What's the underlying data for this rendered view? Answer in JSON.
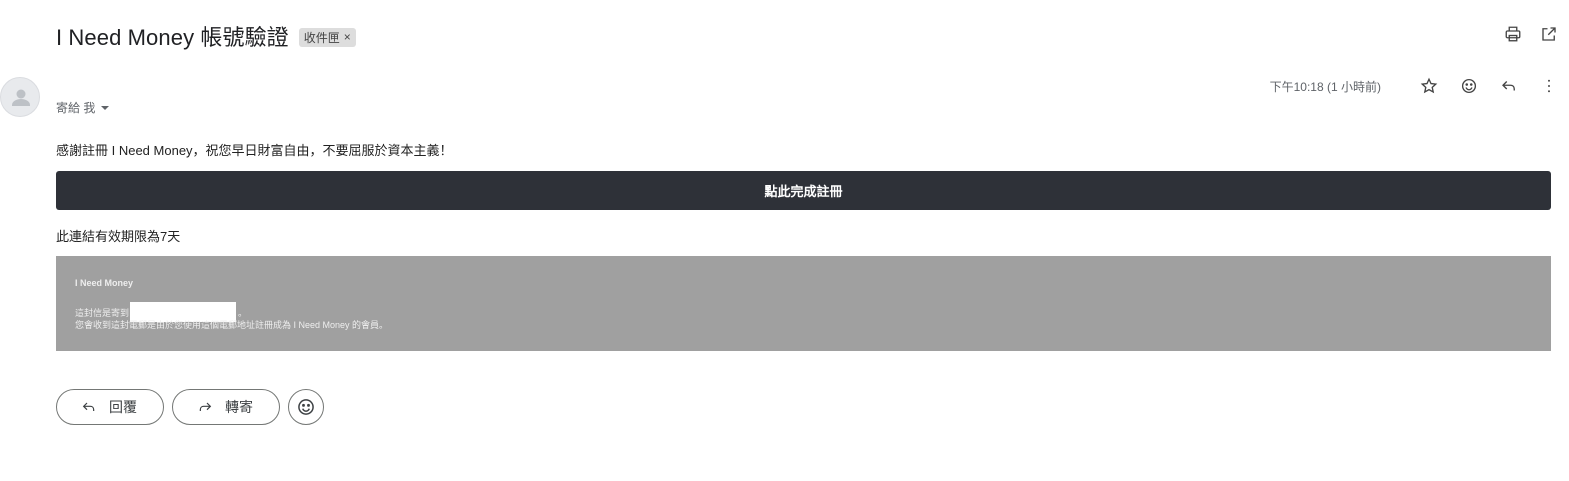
{
  "email": {
    "subject": "I Need Money 帳號驗證",
    "label": "收件匣",
    "label_remove": "×",
    "to_text": "寄給 我",
    "timestamp": "下午10:18 (1 小時前)"
  },
  "icons": {
    "print": "print-icon",
    "open_new_window": "open-in-new-window-icon",
    "star": "star-icon",
    "emoji": "emoji-icon",
    "reply": "reply-icon",
    "more": "more-vert-icon",
    "forward": "forward-icon",
    "avatar": "default-avatar-icon"
  },
  "message": {
    "greeting": "感謝註冊 I Need Money，祝您早日財富自由，不要屈服於資本主義！",
    "cta_label": "點此完成註冊",
    "expiry": "此連結有效期限為7天"
  },
  "footer": {
    "brand": "I Need Money",
    "sent_to_prefix": "這封信是寄到",
    "sent_to_suffix": "。",
    "reason": "您會收到這封電郵是由於您使用這個電郵地址註冊成為 I Need Money 的會員。"
  },
  "actions": {
    "reply_label": "回覆",
    "forward_label": "轉寄"
  },
  "colors": {
    "cta_background": "#2e3138",
    "footer_background": "#a0a0a0",
    "label_chip": "#dddddd"
  }
}
